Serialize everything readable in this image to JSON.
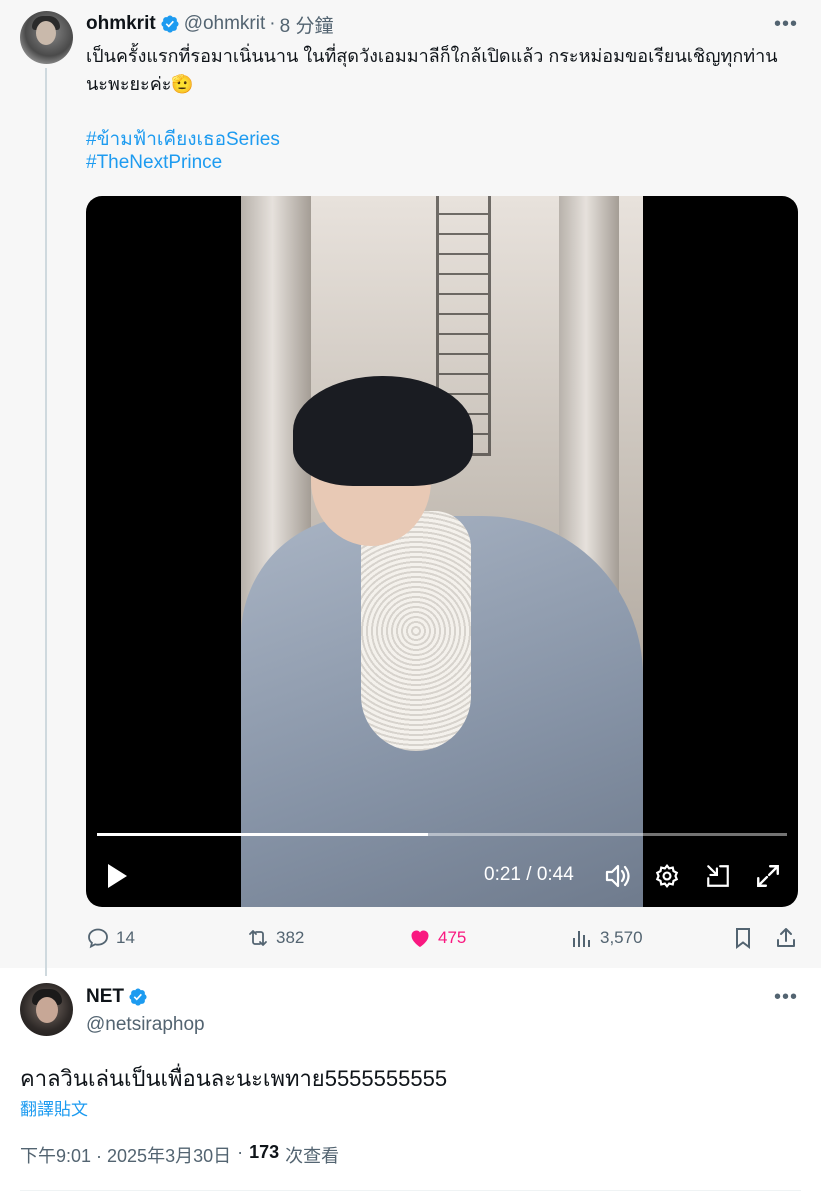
{
  "parent_tweet": {
    "name": "ohmkrit",
    "handle": "@ohmkrit",
    "separator": "·",
    "time": "8 分鐘",
    "more": "•••",
    "text": "เป็นครั้งแรกที่รอมาเนิ่นนาน ในที่สุดวังเอมมาลีก็ใกล้เปิดแล้ว กระหม่อมขอเรียนเชิญทุกท่านนะพะยะค่ะ🫡",
    "hashtags": [
      "#ข้ามฟ้าเคียงเธอSeries",
      "#TheNextPrince"
    ],
    "video": {
      "timecode": "0:21 / 0:44",
      "progress": 0.48
    },
    "actions": {
      "replies": "14",
      "reposts": "382",
      "likes": "475",
      "views": "3,570"
    }
  },
  "reply_tweet": {
    "name": "NET",
    "handle": "@netsiraphop",
    "more": "•••",
    "text": "คาลวินเล่นเป็นเพื่อนละนะเพทาย5555555555",
    "translate_link": "翻譯貼文",
    "timestamp": "下午9:01 · 2025年3月30日",
    "separator": "·",
    "views_count": "173",
    "views_label": "次查看"
  },
  "colors": {
    "accent": "#1d9bf0",
    "like": "#f91880",
    "muted": "#536471",
    "parent_bg": "#f7f7f7"
  },
  "icons": [
    "verified-badge-icon",
    "more-icon",
    "play-icon",
    "volume-icon",
    "settings-icon",
    "dock-icon",
    "fullscreen-icon",
    "reply-icon",
    "repost-icon",
    "like-icon",
    "views-icon",
    "bookmark-icon",
    "share-icon"
  ]
}
